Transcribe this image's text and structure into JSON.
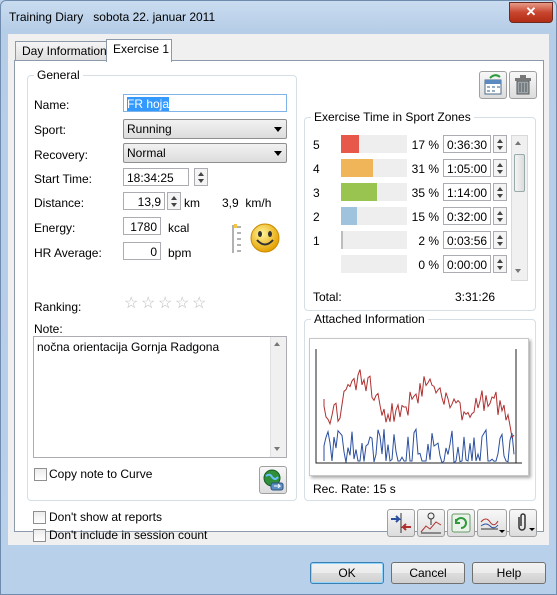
{
  "window": {
    "title": "Training Diary",
    "date": "sobota 22. januar 2011",
    "close_glyph": "✕"
  },
  "tabs": [
    {
      "label": "Day Information",
      "active": false
    },
    {
      "label": "Exercise 1",
      "active": true
    }
  ],
  "general": {
    "group_title": "General",
    "name_label": "Name:",
    "name_value": "FR hoja",
    "sport_label": "Sport:",
    "sport_value": "Running",
    "recovery_label": "Recovery:",
    "recovery_value": "Normal",
    "start_time_label": "Start Time:",
    "start_time_value": "18:34:25",
    "distance_label": "Distance:",
    "distance_value": "13,9",
    "distance_unit": "km",
    "speed_value": "3,9",
    "speed_unit": "km/h",
    "energy_label": "Energy:",
    "energy_value": "1780",
    "energy_unit": "kcal",
    "hr_label": "HR Average:",
    "hr_value": "0",
    "hr_unit": "bpm",
    "ranking_label": "Ranking:",
    "ranking_stars": 0,
    "ranking_max": 5,
    "note_label": "Note:",
    "note_value": "nočna orientacija Gornja Radgona",
    "copy_note_label": "Copy note to Curve",
    "copy_note_checked": false,
    "mood_icon": "smiley-icon"
  },
  "zones": {
    "group_title": "Exercise Time in Sport Zones",
    "rows": [
      {
        "zone": "5",
        "percent": "17 %",
        "time": "0:36:30",
        "fraction": 0.17,
        "color": "#e8584a"
      },
      {
        "zone": "4",
        "percent": "31 %",
        "time": "1:05:00",
        "fraction": 0.31,
        "color": "#f0b459"
      },
      {
        "zone": "3",
        "percent": "35 %",
        "time": "1:14:00",
        "fraction": 0.35,
        "color": "#9ac450"
      },
      {
        "zone": "2",
        "percent": "15 %",
        "time": "0:32:00",
        "fraction": 0.15,
        "color": "#9fc3dc"
      },
      {
        "zone": "1",
        "percent": "2 %",
        "time": "0:03:56",
        "fraction": 0.02,
        "color": "#bdbdbd"
      },
      {
        "zone": "",
        "percent": "0 %",
        "time": "0:00:00",
        "fraction": 0.0,
        "color": "#bdbdbd"
      }
    ],
    "total_label": "Total:",
    "total_value": "3:31:26"
  },
  "attached": {
    "group_title": "Attached Information",
    "rec_rate": "Rec. Rate: 15 s",
    "series_colors": {
      "hr": "#b03030",
      "speed": "#2b4fa0"
    }
  },
  "bottom": {
    "dont_show_label": "Don't show at reports",
    "dont_show_checked": false,
    "dont_include_label": "Don't include in session count",
    "dont_include_checked": false
  },
  "buttons": {
    "ok": "OK",
    "cancel": "Cancel",
    "help": "Help"
  }
}
